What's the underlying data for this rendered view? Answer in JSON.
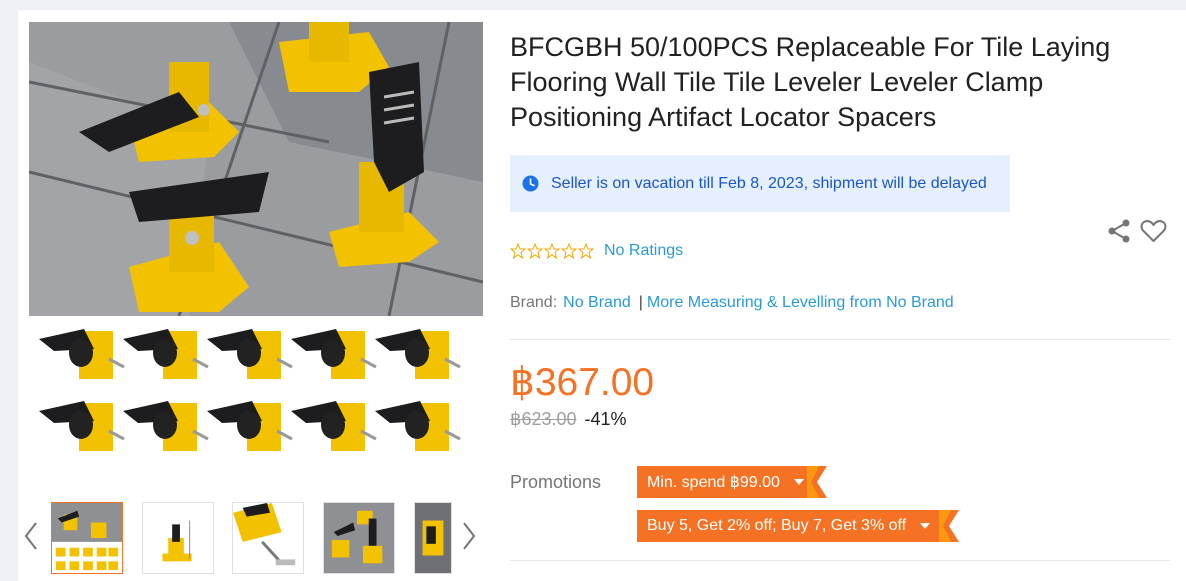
{
  "product": {
    "title": "BFCGBH 50/100PCS Replaceable For Tile Laying Flooring Wall Tile Tile Leveler Leveler Clamp Positioning Artifact Locator Spacers"
  },
  "notice": {
    "text": "Seller is on vacation till Feb 8, 2023, shipment will be delayed"
  },
  "rating": {
    "text": "No Ratings",
    "stars": 5
  },
  "brand": {
    "label": "Brand:",
    "name": "No Brand",
    "separator": "|",
    "more": "More Measuring & Levelling from No Brand"
  },
  "pricing": {
    "price": "฿367.00",
    "original": "฿623.00",
    "discount": "-41%"
  },
  "promotions": {
    "label": "Promotions",
    "items": [
      "Min. spend ฿99.00",
      "Buy 5, Get 2% off; Buy 7, Get 3% off"
    ]
  },
  "colors": {
    "accent": "#f57224",
    "link": "#2a9ad6",
    "notice_bg": "#e6effe",
    "notice_text": "#1a56c6"
  },
  "icons": [
    "chevron-left-icon",
    "chevron-right-icon",
    "clock-icon",
    "share-icon",
    "heart-icon",
    "star-outline-icon",
    "caret-down-icon"
  ]
}
